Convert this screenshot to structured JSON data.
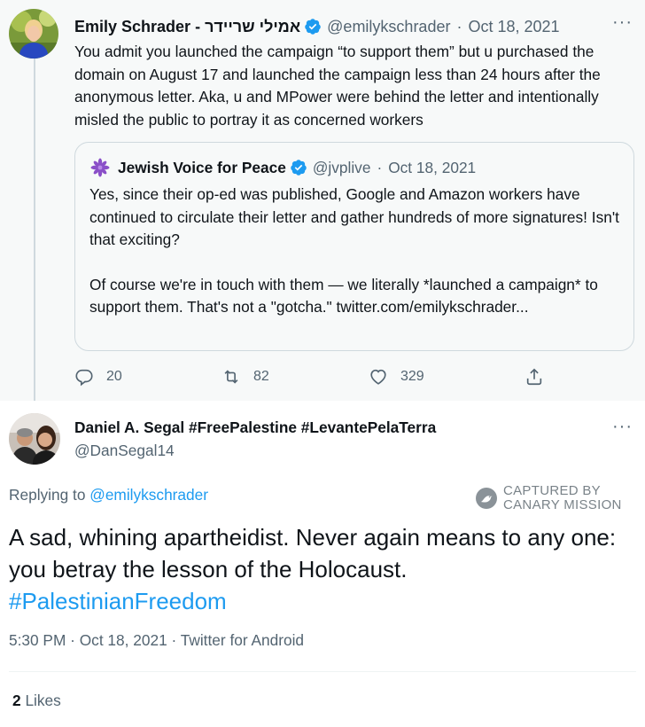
{
  "parent_tweet": {
    "author_name": "Emily Schrader - אמילי שריידר",
    "handle": "@emilykschrader",
    "separator": "·",
    "date": "Oct 18, 2021",
    "text": "You admit you launched the campaign “to support them” but u purchased the domain on August 17 and launched the campaign less than 24 hours after the anonymous letter. Aka, u and MPower were behind the letter and intentionally misled the public to portray it as concerned workers",
    "quoted_tweet": {
      "author_name": "Jewish Voice for Peace",
      "handle": "@jvplive",
      "separator": "·",
      "date": "Oct 18, 2021",
      "paragraph1": "Yes, since their op-ed was published, Google and Amazon workers have continued to circulate their letter and gather hundreds of more signatures! Isn't that exciting?",
      "paragraph2": "Of course we're in touch with them — we literally *launched a campaign* to support them. That's not a \"gotcha.\" twitter.com/emilykschrader..."
    },
    "actions": {
      "replies": "20",
      "retweets": "82",
      "likes": "329"
    }
  },
  "reply_tweet": {
    "author_name": "Daniel A. Segal #FreePalestine #LevantePelaTerra",
    "handle": "@DanSegal14",
    "replying_prefix": "Replying to",
    "replying_to": "@emilykschrader",
    "text": "A sad, whining apartheidist. Never again means to any one: you betray the lesson of the Holocaust.",
    "hashtag": "#PalestinianFreedom",
    "time": "5:30 PM",
    "date": "Oct 18, 2021",
    "source": "Twitter for Android",
    "likes_count": "2",
    "likes_label": "Likes"
  },
  "watermark": {
    "line1": "CAPTURED BY",
    "line2": "CANARY MISSION"
  },
  "colors": {
    "link_blue": "#1d9bf0",
    "secondary_text": "#536471",
    "verified_blue": "#1d9bf0",
    "parent_background": "#f7f9f9"
  }
}
